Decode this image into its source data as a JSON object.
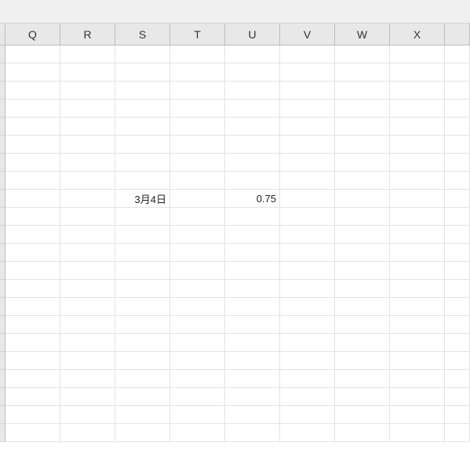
{
  "columns": [
    "Q",
    "R",
    "S",
    "T",
    "U",
    "V",
    "W",
    "X"
  ],
  "narrow_column_index": 8,
  "row_count": 22,
  "cells": {
    "r8_c2": "3月4日",
    "r8_c4": "0.75"
  }
}
